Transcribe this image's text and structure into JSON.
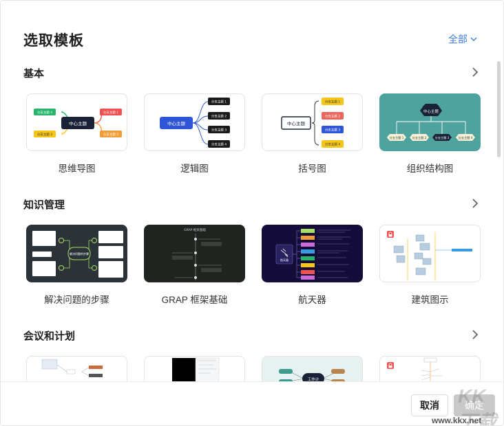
{
  "dialog": {
    "title": "选取模板",
    "filter_label": "全部"
  },
  "sections": [
    {
      "title": "基本",
      "cards": [
        {
          "label": "思维导图",
          "center": "中心主题",
          "branches": [
            "分支主题 4",
            "分支主题 1",
            "分支主题 3",
            "分支主题 2"
          ]
        },
        {
          "label": "逻辑图",
          "center": "中心主题",
          "branches": [
            "分支主题 1",
            "分支主题 2",
            "分支主题 3",
            "分支主题 4"
          ]
        },
        {
          "label": "括号图",
          "center": "中心主题",
          "branches": [
            "分支主题 1",
            "分支主题 2",
            "分支主题 3",
            "分支主题 4"
          ]
        },
        {
          "label": "组织结构图",
          "center": "中心主题",
          "branches": [
            "分支主题 1",
            "分支主题 2",
            "分支主题 3",
            "分支主题 4"
          ]
        }
      ]
    },
    {
      "title": "知识管理",
      "cards": [
        {
          "label": "解决问题的步骤",
          "center": "解决问题的步骤"
        },
        {
          "label": "GRAP 框架基础",
          "center": "GRAP 框架基础"
        },
        {
          "label": "航天器",
          "center": "航天器"
        },
        {
          "label": "建筑图示"
        }
      ]
    },
    {
      "title": "会议和计划",
      "cards": [
        {
          "label": ""
        },
        {
          "label": ""
        },
        {
          "label": "",
          "center": "工作计"
        },
        {
          "label": ""
        }
      ]
    }
  ],
  "footer": {
    "cancel_label": "取消",
    "confirm_label": "确定"
  },
  "watermark": {
    "text": "KK下载",
    "url": "www.kkx.net"
  },
  "colors": {
    "accent": "#3a7be0",
    "green": "#27b46b",
    "red": "#f0504f",
    "yellow": "#f5c518",
    "orange": "#f29c38",
    "navy": "#1a2238",
    "blue": "#2f56d9",
    "teal": "#4fa39e"
  }
}
